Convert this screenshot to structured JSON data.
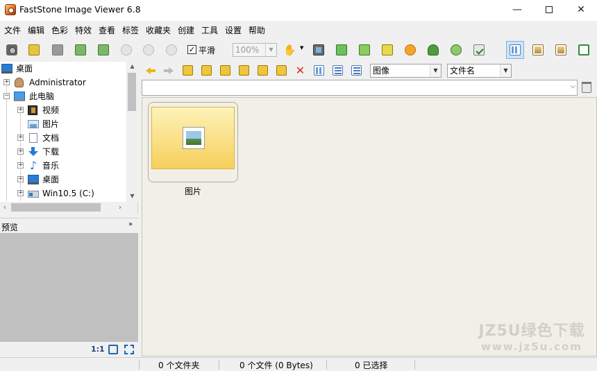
{
  "window": {
    "title": "FastStone Image Viewer 6.8",
    "minimize_glyph": "—",
    "close_glyph": "✕"
  },
  "menu": {
    "items": [
      "文件",
      "编辑",
      "色彩",
      "特效",
      "查看",
      "标签",
      "收藏夹",
      "创建",
      "工具",
      "设置",
      "帮助"
    ]
  },
  "toolbar": {
    "smooth_label": "平滑",
    "smooth_checked": true,
    "smooth_glyph": "✓",
    "zoom_value": "100%",
    "dropdown_glyph": "▼",
    "hand_glyph": "✋",
    "icons": [
      "camera-icon",
      "open-folder-icon",
      "save-icon",
      "previous-icon",
      "next-icon",
      "zoom-in-icon",
      "zoom-out-icon",
      "actual-size-icon",
      "hand-tool-icon",
      "slideshow-icon",
      "resize-icon",
      "crop-icon",
      "color-balance-icon",
      "lighting-icon",
      "red-eye-icon",
      "undo-icon",
      "batch-icon",
      "thumbnail-view-icon",
      "preview-view-icon",
      "browser-view-icon",
      "fullscreen-view-icon"
    ]
  },
  "tree": {
    "items": [
      {
        "label": "桌面",
        "icon": "desktop-icon"
      },
      {
        "label": "Administrator",
        "icon": "user-icon"
      },
      {
        "label": "此电脑",
        "icon": "computer-icon"
      },
      {
        "label": "视频",
        "icon": "video-folder-icon"
      },
      {
        "label": "图片",
        "icon": "picture-folder-icon"
      },
      {
        "label": "文档",
        "icon": "documents-folder-icon"
      },
      {
        "label": "下载",
        "icon": "downloads-folder-icon"
      },
      {
        "label": "音乐",
        "icon": "music-folder-icon"
      },
      {
        "label": "桌面",
        "icon": "desktop-icon"
      },
      {
        "label": "Win10.5 (C:)",
        "icon": "drive-icon"
      }
    ],
    "expand_glyph": "+",
    "collapse_glyph": "−",
    "note_glyph": "♪",
    "scroll_up": "▲",
    "scroll_down": "▼",
    "scroll_left": "‹",
    "scroll_right": "›"
  },
  "preview": {
    "title": "预览",
    "collapse_glyph": "»",
    "ratio_label": "1:1"
  },
  "browser": {
    "x_glyph": "✕",
    "filter_value": "图像",
    "sort_value": "文件名",
    "path_value": "",
    "path_dd": "⌵"
  },
  "thumbnails": [
    {
      "label": "图片",
      "type": "folder"
    }
  ],
  "watermark": {
    "top": "JZ5U绿色下载",
    "bottom": "www.jz5u.com"
  },
  "status": {
    "folders": "0 个文件夹",
    "files": "0 个文件 (0 Bytes)",
    "selected": "0 已选择"
  },
  "colors": {
    "accent_blue": "#2b7bd4",
    "thumb_bg": "#f2f0e6",
    "folder_yellow": "#f7cf5a",
    "preview_bg": "#c0c0c0"
  }
}
